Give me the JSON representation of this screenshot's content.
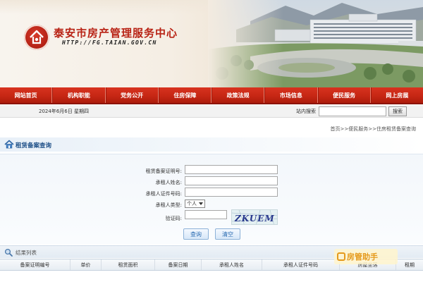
{
  "header": {
    "site_title": "泰安市房产管理服务中心",
    "site_url": "HTTP://FG.TAIAN.GOV.CN"
  },
  "nav": {
    "items": [
      {
        "label": "网站首页"
      },
      {
        "label": "机构职能"
      },
      {
        "label": "党务公开"
      },
      {
        "label": "住房保障"
      },
      {
        "label": "政策法规"
      },
      {
        "label": "市场信息"
      },
      {
        "label": "便民服务"
      },
      {
        "label": "网上房展"
      }
    ]
  },
  "infobar": {
    "date": "2024年6月6日 星期四",
    "search_label": "站内搜索",
    "search_value": "",
    "search_button": "搜索"
  },
  "breadcrumb": "首页>>便民服务>>住房租赁备案查询",
  "section": {
    "title": "租赁备案查询"
  },
  "form": {
    "cert_no_label": "租赁备案证明号:",
    "cert_no_value": "",
    "lessee_name_label": "承租人姓名:",
    "lessee_name_value": "",
    "lessee_id_label": "承租人证件号码:",
    "lessee_id_value": "",
    "lessee_type_label": "承租人类型:",
    "lessee_type_value": "个人",
    "captcha_label": "验证码:",
    "captcha_value": "",
    "captcha_text": "ZKUEM",
    "query_button": "查询",
    "clear_button": "清空"
  },
  "results": {
    "title": "结果列表",
    "columns": [
      "备案证明编号",
      "单价",
      "租赁面积",
      "备案日期",
      "承租人姓名",
      "承租人证件号码",
      "房屋坐落",
      "租期"
    ]
  },
  "watermark": {
    "text": "房管助手"
  },
  "colors": {
    "brand_red": "#c62714",
    "title_red": "#b82214",
    "section_blue": "#1d4f87",
    "button_blue": "#2b6cb2",
    "watermark_orange": "#e59a1c"
  },
  "icons": [
    "emblem-logo",
    "house-icon",
    "magnifier-icon",
    "watermark-logo-icon"
  ]
}
